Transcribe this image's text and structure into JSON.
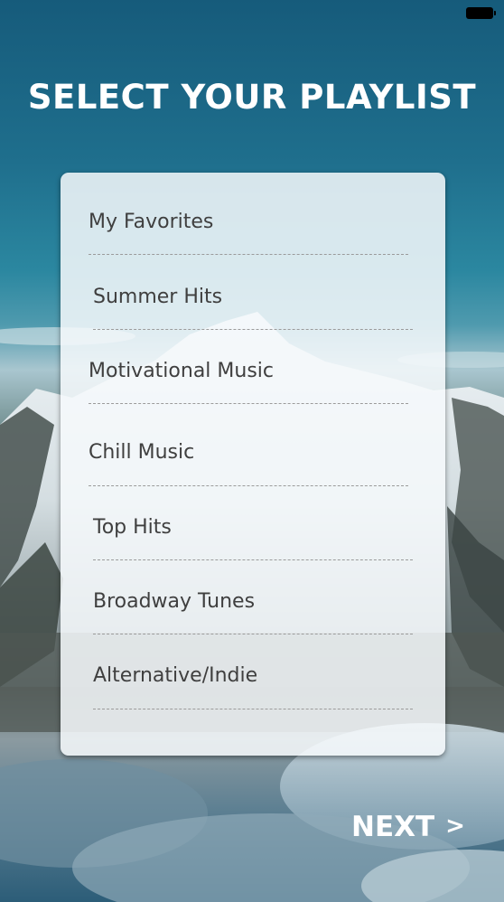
{
  "screen": {
    "title": "SELECT YOUR PLAYLIST"
  },
  "playlists": [
    {
      "label": "My Favorites"
    },
    {
      "label": "Summer Hits"
    },
    {
      "label": "Motivational Music"
    },
    {
      "label": "Chill Music"
    },
    {
      "label": "Top Hits"
    },
    {
      "label": "Broadway Tunes"
    },
    {
      "label": "Alternative/Indie"
    }
  ],
  "footer": {
    "next_label": "NEXT",
    "next_icon": ">"
  },
  "theme": {
    "card_background": "#f6f9fc",
    "text_color": "#3f3f3f",
    "title_color": "#ffffff"
  }
}
